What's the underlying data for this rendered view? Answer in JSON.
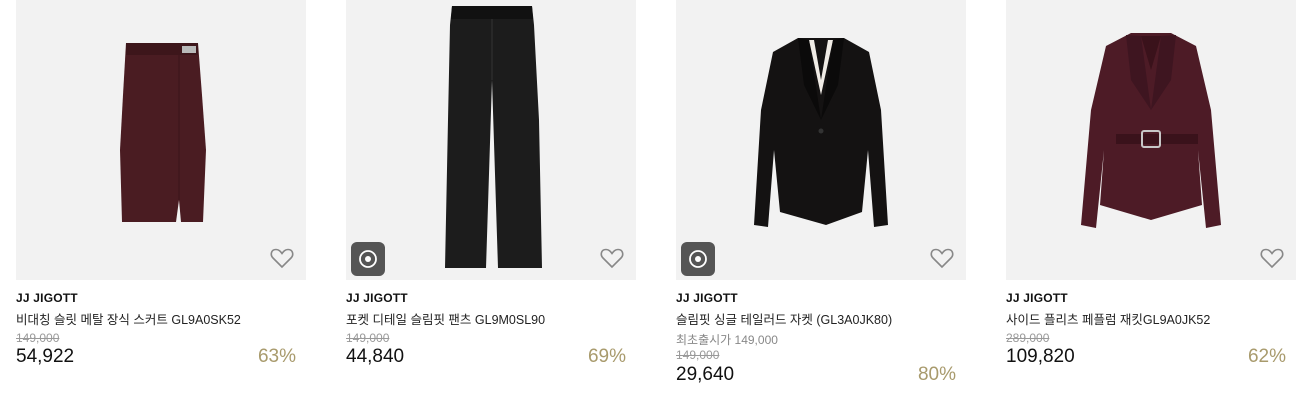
{
  "products": [
    {
      "brand": "JJ JIGOTT",
      "name": "비대칭 슬릿 메탈 장식 스커트 GL9A0SK52",
      "original_price": "149,000",
      "price": "54,922",
      "discount": "63%",
      "has_video": false,
      "color": "#4a1c22"
    },
    {
      "brand": "JJ JIGOTT",
      "name": "포켓 디테일 슬림핏 팬츠 GL9M0SL90",
      "original_price": "149,000",
      "price": "44,840",
      "discount": "69%",
      "has_video": true,
      "color": "#1c1c1c"
    },
    {
      "brand": "JJ JIGOTT",
      "name": "슬림핏 싱글 테일러드 자켓 (GL3A0JK80)",
      "first_release": "최초출시가 149,000",
      "original_price": "149,000",
      "price": "29,640",
      "discount": "80%",
      "has_video": true,
      "color": "#141212"
    },
    {
      "brand": "JJ JIGOTT",
      "name": "사이드 플리츠 페플럼 재킷GL9A0JK52",
      "original_price": "289,000",
      "price": "109,820",
      "discount": "62%",
      "has_video": false,
      "color": "#4d1b26"
    }
  ]
}
